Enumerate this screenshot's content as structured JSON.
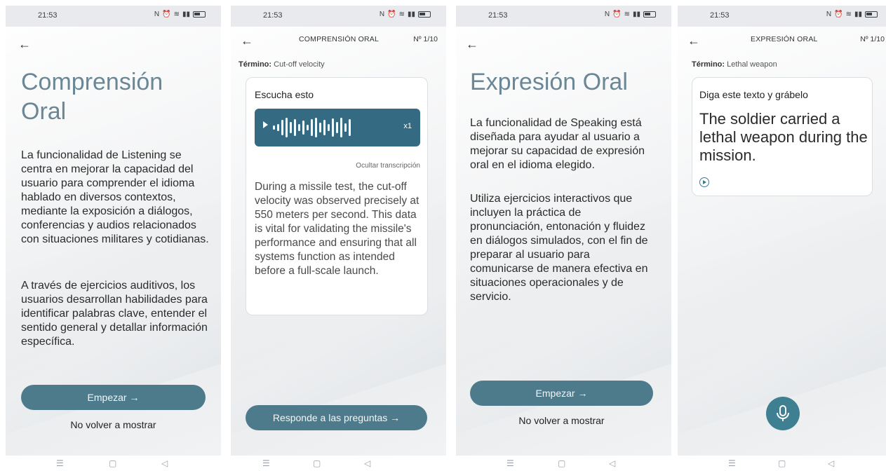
{
  "status": {
    "time": "21:53"
  },
  "screen1": {
    "title": "Comprensión Oral",
    "paragraph1": "La funcionalidad de Listening se centra en mejorar la capacidad del usuario para comprender el idioma hablado en diversos contextos, mediante la exposición a diálogos, conferencias y audios relacionados con situaciones militares y cotidianas.",
    "paragraph2": "A través de ejercicios auditivos, los usuarios desarrollan habilidades para identificar palabras clave, entender el sentido general y detallar información específica.",
    "start_button": "Empezar →",
    "dont_show": "No volver a mostrar"
  },
  "screen2": {
    "header_title": "COMPRENSIÓN ORAL",
    "counter": "Nº 1/10",
    "term_label": "Término:",
    "term_value": "Cut-off velocity",
    "card_label": "Escucha esto",
    "audio_speed": "x1",
    "hide_transcription": "Ocultar transcripción",
    "transcript": "During a missile test, the cut-off velocity was observed precisely at 550 meters per second. This data is vital for validating the missile's performance and ensuring that all systems function as intended before a full-scale launch.",
    "answer_button": "Responde a las preguntas →"
  },
  "screen3": {
    "title": "Expresión Oral",
    "paragraph1": "La funcionalidad de Speaking está diseñada para ayudar al usuario a mejorar su capacidad de expresión oral en el idioma elegido.",
    "paragraph2": "Utiliza ejercicios interactivos que incluyen la práctica de pronunciación, entonación y fluidez en diálogos simulados, con el fin de preparar al usuario para comunicarse de manera efectiva en situaciones operacionales y de servicio.",
    "start_button": "Empezar →",
    "dont_show": "No volver a mostrar"
  },
  "screen4": {
    "header_title": "EXPRESIÓN ORAL",
    "counter": "Nº 1/10",
    "term_label": "Término:",
    "term_value": "Lethal weapon",
    "card_label": "Diga este texto y grábelo",
    "sentence": "The soldier carried a lethal weapon during the mission."
  },
  "colors": {
    "accent": "#4e7b8c",
    "title": "#6b8795",
    "audio_bg": "#356b82"
  },
  "icons": {
    "back": "arrow-left-icon",
    "play": "play-icon",
    "mic": "microphone-icon"
  }
}
